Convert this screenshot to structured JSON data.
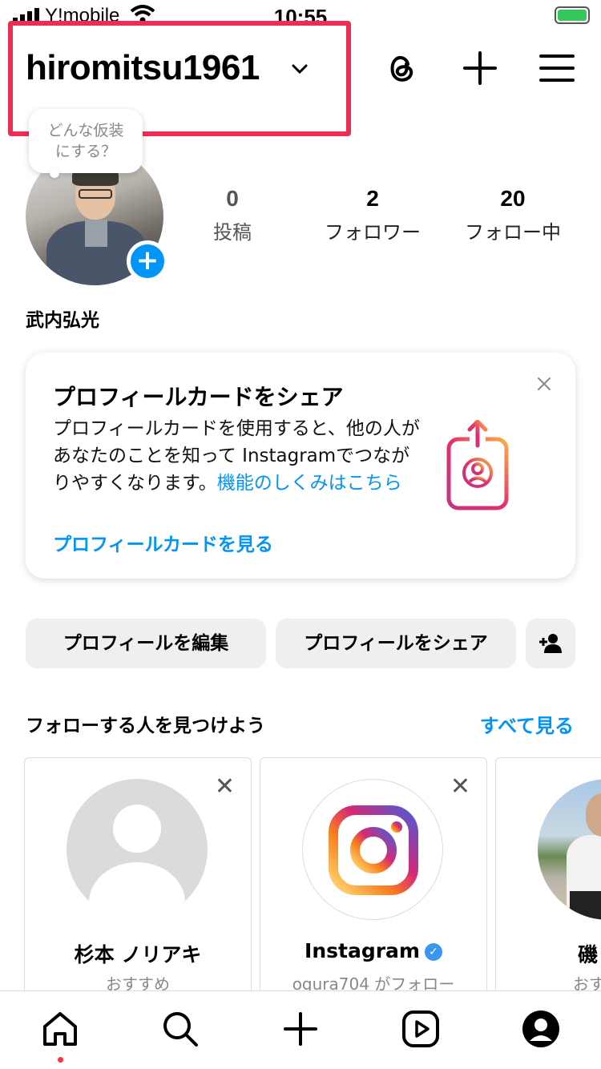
{
  "status_bar": {
    "carrier": "Y!mobile",
    "time": "10:55"
  },
  "header": {
    "username": "hiromitsu1961",
    "icons": [
      "chevron-down-icon",
      "threads-icon",
      "plus-icon",
      "hamburger-menu-icon"
    ]
  },
  "profile": {
    "bubble_text_line1": "どんな仮装",
    "bubble_text_line2": "にする？",
    "full_name": "武内弘光",
    "stats": [
      {
        "value": "0",
        "label": "投稿"
      },
      {
        "value": "2",
        "label": "フォロワー"
      },
      {
        "value": "20",
        "label": "フォロー中"
      }
    ]
  },
  "profile_card": {
    "title": "プロフィールカードをシェア",
    "body": "プロフィールカードを使用すると、他の人があなたのことを知って Instagramでつながりやすくなります。",
    "body_link": "機能のしくみはこちら",
    "cta": "プロフィールカードを見る"
  },
  "buttons": {
    "edit_profile": "プロフィールを編集",
    "share_profile": "プロフィールをシェア"
  },
  "suggestions": {
    "title": "フォローする人を見つけよう",
    "see_all": "すべて見る",
    "cards": [
      {
        "name": "杉本 ノリアキ",
        "sub": "おすすめ"
      },
      {
        "name": "Instagram",
        "sub": "ogura704 がフォロー"
      },
      {
        "name": "磯",
        "sub": "おす"
      }
    ]
  },
  "bottom_nav": {
    "items": [
      "home-icon",
      "search-icon",
      "create-icon",
      "reels-icon",
      "profile-icon"
    ]
  },
  "colors": {
    "accent": "#0095f6",
    "highlight": "#ee2d55",
    "notification_dot": "#ff3040"
  }
}
